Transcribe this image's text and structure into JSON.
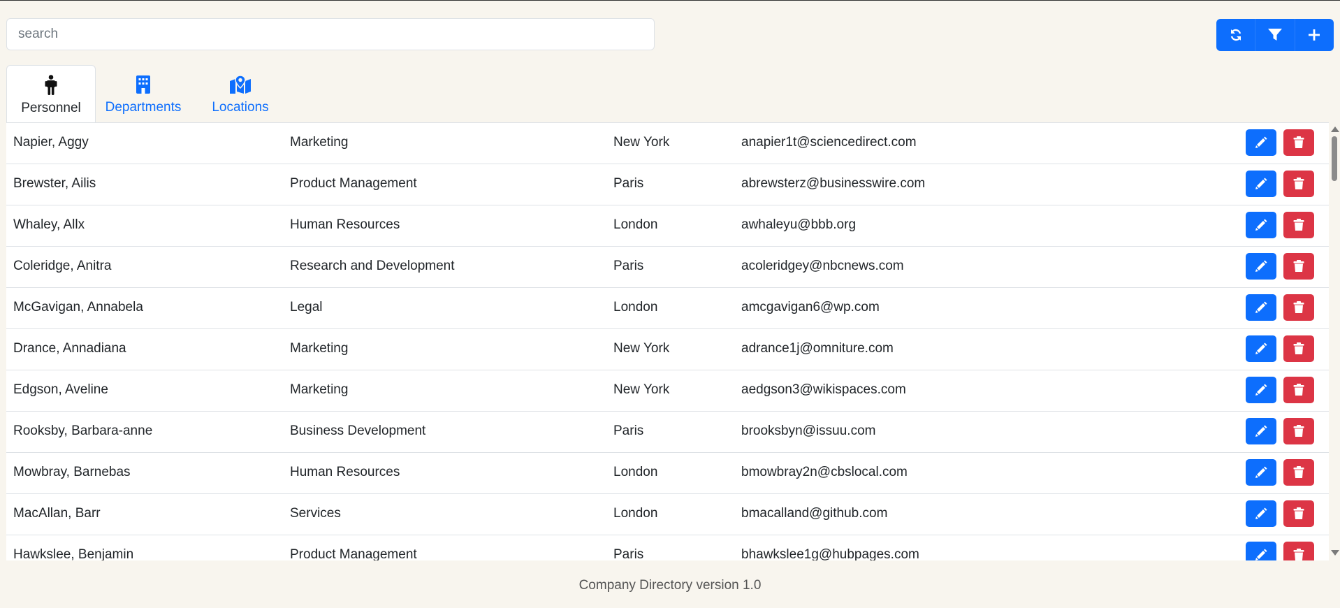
{
  "search": {
    "placeholder": "search",
    "value": ""
  },
  "toolbar": {
    "buttons": [
      {
        "name": "refresh-button",
        "icon": "refresh-icon"
      },
      {
        "name": "filter-button",
        "icon": "filter-icon"
      },
      {
        "name": "add-button",
        "icon": "plus-icon"
      }
    ],
    "color": "#0d6efd"
  },
  "tabs": [
    {
      "label": "Personnel",
      "icon": "person-icon",
      "active": true
    },
    {
      "label": "Departments",
      "icon": "building-icon",
      "active": false
    },
    {
      "label": "Locations",
      "icon": "map-location-icon",
      "active": false
    }
  ],
  "rows": [
    {
      "name": "Napier, Aggy",
      "department": "Marketing",
      "location": "New York",
      "email": "anapier1t@sciencedirect.com"
    },
    {
      "name": "Brewster, Ailis",
      "department": "Product Management",
      "location": "Paris",
      "email": "abrewsterz@businesswire.com"
    },
    {
      "name": "Whaley, Allx",
      "department": "Human Resources",
      "location": "London",
      "email": "awhaleyu@bbb.org"
    },
    {
      "name": "Coleridge, Anitra",
      "department": "Research and Development",
      "location": "Paris",
      "email": "acoleridgey@nbcnews.com"
    },
    {
      "name": "McGavigan, Annabela",
      "department": "Legal",
      "location": "London",
      "email": "amcgavigan6@wp.com"
    },
    {
      "name": "Drance, Annadiana",
      "department": "Marketing",
      "location": "New York",
      "email": "adrance1j@omniture.com"
    },
    {
      "name": "Edgson, Aveline",
      "department": "Marketing",
      "location": "New York",
      "email": "aedgson3@wikispaces.com"
    },
    {
      "name": "Rooksby, Barbara-anne",
      "department": "Business Development",
      "location": "Paris",
      "email": "brooksbyn@issuu.com"
    },
    {
      "name": "Mowbray, Barnebas",
      "department": "Human Resources",
      "location": "London",
      "email": "bmowbray2n@cbslocal.com"
    },
    {
      "name": "MacAllan, Barr",
      "department": "Services",
      "location": "London",
      "email": "bmacalland@github.com"
    },
    {
      "name": "Hawkslee, Benjamin",
      "department": "Product Management",
      "location": "Paris",
      "email": "bhawkslee1g@hubpages.com"
    }
  ],
  "row_actions": {
    "edit_icon": "pencil-icon",
    "delete_icon": "trash-icon",
    "edit_color": "#0d6efd",
    "delete_color": "#dc3545"
  },
  "footer": {
    "text": "Company Directory version 1.0"
  }
}
